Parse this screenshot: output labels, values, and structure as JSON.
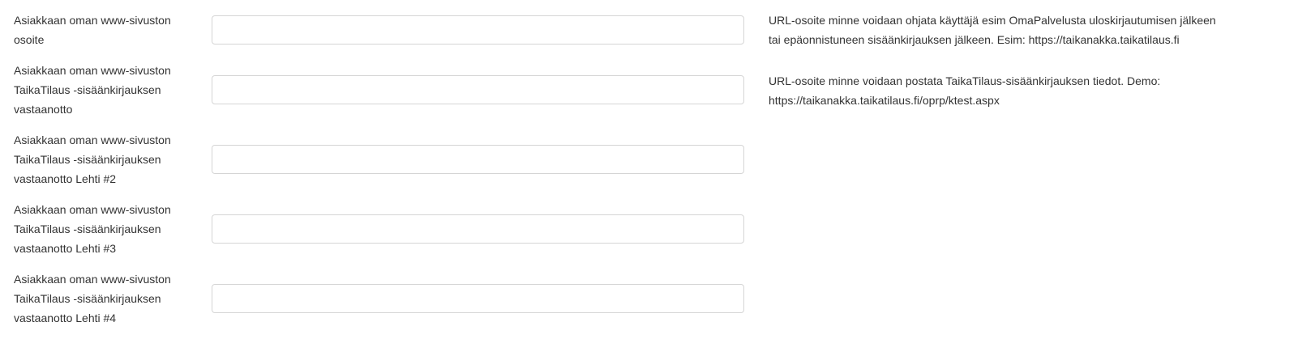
{
  "fields": [
    {
      "label_lines": [
        "Asiakkaan oman www-sivuston",
        "osoite"
      ],
      "value": "",
      "placeholder": "",
      "help_lines": [
        "URL-osoite minne voidaan ohjata käyttäjä esim OmaPalvelusta uloskirjautumisen jälkeen",
        "tai epäonnistuneen sisäänkirjauksen jälkeen. Esim: https://taikanakka.taikatilaus.fi"
      ]
    },
    {
      "label_lines": [
        "Asiakkaan oman www-sivuston",
        "TaikaTilaus -sisäänkirjauksen",
        "vastaanotto"
      ],
      "value": "",
      "placeholder": "",
      "help_lines": [
        "URL-osoite minne voidaan postata TaikaTilaus-sisäänkirjauksen tiedot. Demo:",
        "https://taikanakka.taikatilaus.fi/oprp/ktest.aspx"
      ]
    },
    {
      "label_lines": [
        "Asiakkaan oman www-sivuston",
        "TaikaTilaus -sisäänkirjauksen",
        "vastaanotto Lehti #2"
      ],
      "value": "",
      "placeholder": ""
    },
    {
      "label_lines": [
        "Asiakkaan oman www-sivuston",
        "TaikaTilaus -sisäänkirjauksen",
        "vastaanotto Lehti #3"
      ],
      "value": "",
      "placeholder": ""
    },
    {
      "label_lines": [
        "Asiakkaan oman www-sivuston",
        "TaikaTilaus -sisäänkirjauksen",
        "vastaanotto Lehti #4"
      ],
      "value": "",
      "placeholder": ""
    }
  ]
}
